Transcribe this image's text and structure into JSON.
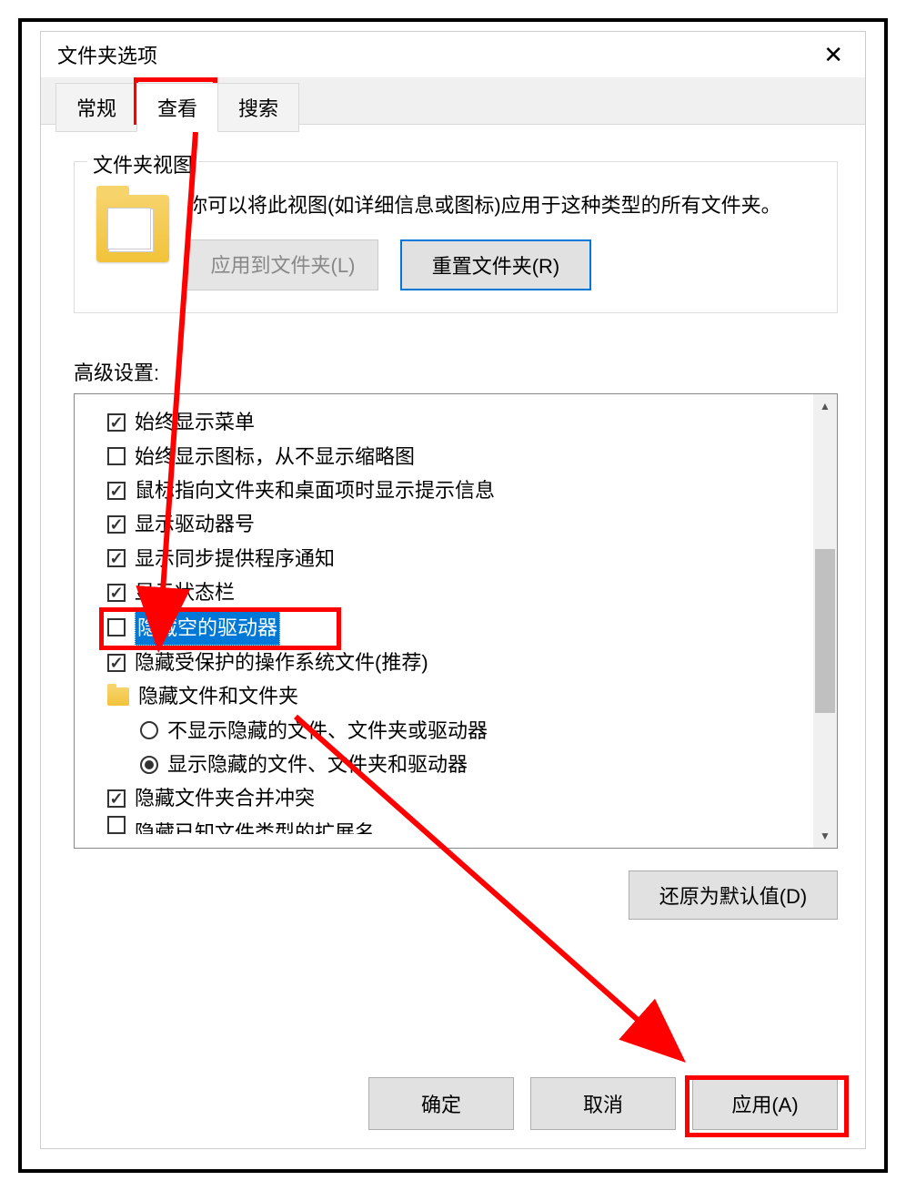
{
  "dialog": {
    "title": "文件夹选项",
    "tabs": [
      "常规",
      "查看",
      "搜索"
    ],
    "active_tab_index": 1
  },
  "folder_view": {
    "group_title": "文件夹视图",
    "description": "你可以将此视图(如详细信息或图标)应用于这种类型的所有文件夹。",
    "apply_to_folders_btn": "应用到文件夹(L)",
    "reset_folders_btn": "重置文件夹(R)"
  },
  "advanced": {
    "label": "高级设置:",
    "items": [
      {
        "type": "checkbox",
        "checked": true,
        "label": "始终显示菜单"
      },
      {
        "type": "checkbox",
        "checked": false,
        "label": "始终显示图标，从不显示缩略图"
      },
      {
        "type": "checkbox",
        "checked": true,
        "label": "鼠标指向文件夹和桌面项时显示提示信息"
      },
      {
        "type": "checkbox",
        "checked": true,
        "label": "显示驱动器号"
      },
      {
        "type": "checkbox",
        "checked": true,
        "label": "显示同步提供程序通知"
      },
      {
        "type": "checkbox",
        "checked": true,
        "label": "显示状态栏"
      },
      {
        "type": "checkbox",
        "checked": false,
        "label": "隐藏空的驱动器",
        "selected": true,
        "highlighted": true
      },
      {
        "type": "checkbox",
        "checked": true,
        "label": "隐藏受保护的操作系统文件(推荐)"
      },
      {
        "type": "folder",
        "label": "隐藏文件和文件夹"
      },
      {
        "type": "radio",
        "checked": false,
        "indent": 1,
        "label": "不显示隐藏的文件、文件夹或驱动器"
      },
      {
        "type": "radio",
        "checked": true,
        "indent": 1,
        "label": "显示隐藏的文件、文件夹和驱动器"
      },
      {
        "type": "checkbox",
        "checked": true,
        "label": "隐藏文件夹合并冲突"
      },
      {
        "type": "checkbox",
        "checked": false,
        "label": "隐藏已知文件类型的扩展名",
        "cutoff": true
      }
    ],
    "restore_defaults_btn": "还原为默认值(D)"
  },
  "buttons": {
    "ok": "确定",
    "cancel": "取消",
    "apply": "应用(A)"
  }
}
